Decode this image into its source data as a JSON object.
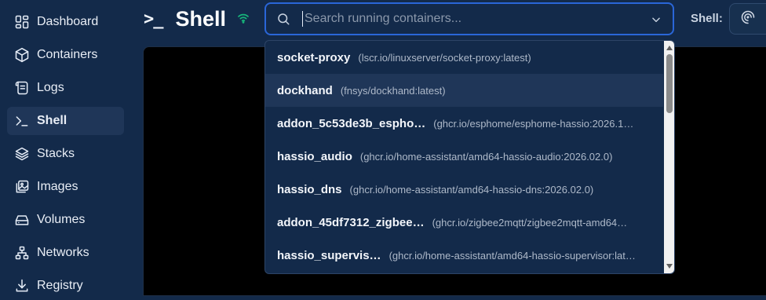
{
  "sidebar": {
    "items": [
      {
        "label": "Dashboard",
        "icon": "dashboard-icon"
      },
      {
        "label": "Containers",
        "icon": "box-icon"
      },
      {
        "label": "Logs",
        "icon": "scroll-icon"
      },
      {
        "label": "Shell",
        "icon": "terminal-icon",
        "active": true
      },
      {
        "label": "Stacks",
        "icon": "layers-icon"
      },
      {
        "label": "Images",
        "icon": "images-icon"
      },
      {
        "label": "Volumes",
        "icon": "hard-drive-icon"
      },
      {
        "label": "Networks",
        "icon": "network-icon"
      },
      {
        "label": "Registry",
        "icon": "download-icon"
      }
    ]
  },
  "header": {
    "prompt": ">_",
    "title": "Shell",
    "connection_icon": "wifi-icon",
    "status_color": "#16b47a"
  },
  "search": {
    "placeholder": "Search running containers..."
  },
  "shell_selector": {
    "label": "Shell:",
    "icon": "shell-icon"
  },
  "dropdown": {
    "items": [
      {
        "name": "socket-proxy",
        "image": "(lscr.io/linuxserver/socket-proxy:latest)"
      },
      {
        "name": "dockhand",
        "image": "(fnsys/dockhand:latest)",
        "hover": true
      },
      {
        "name": "addon_5c53de3b_espho…",
        "image": "(ghcr.io/esphome/esphome-hassio:2026.1…"
      },
      {
        "name": "hassio_audio",
        "image": "(ghcr.io/home-assistant/amd64-hassio-audio:2026.02.0)"
      },
      {
        "name": "hassio_dns",
        "image": "(ghcr.io/home-assistant/amd64-hassio-dns:2026.02.0)"
      },
      {
        "name": "addon_45df7312_zigbee…",
        "image": "(ghcr.io/zigbee2mqtt/zigbee2mqtt-amd64…"
      },
      {
        "name": "hassio_supervis…",
        "image": "(ghcr.io/home-assistant/amd64-hassio-supervisor:lat…"
      }
    ]
  },
  "colors": {
    "accent": "#2a66d8",
    "background": "#132a4a",
    "terminal": "#000000"
  }
}
